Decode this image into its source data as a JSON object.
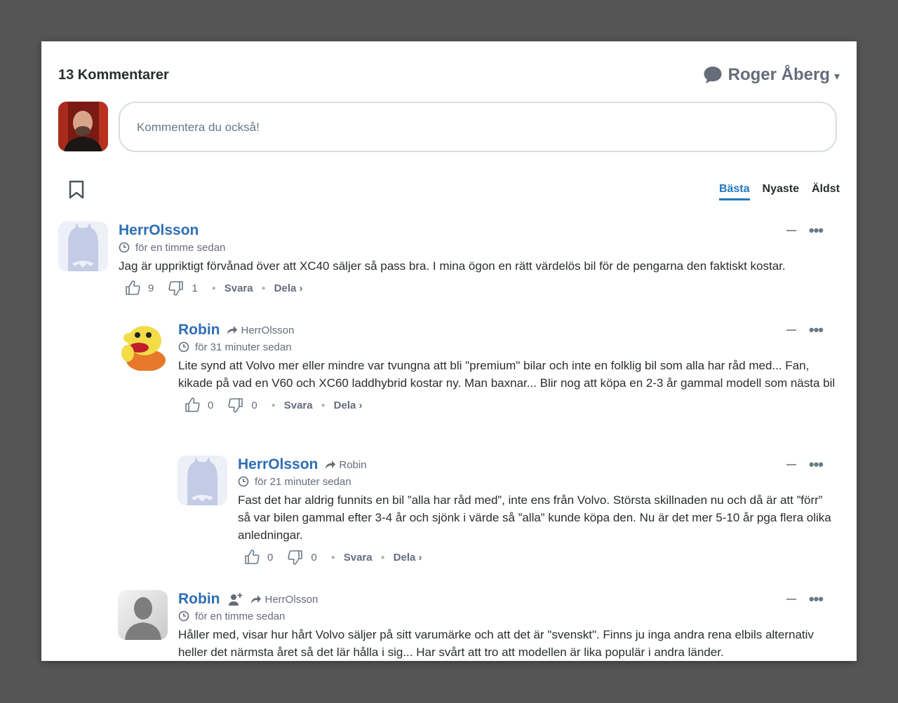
{
  "header": {
    "count_label": "13 Kommentarer",
    "user_name": "Roger Åberg",
    "caret": "▾"
  },
  "composer": {
    "placeholder": "Kommentera du också!"
  },
  "sort": {
    "best": "Bästa",
    "newest": "Nyaste",
    "oldest": "Äldst"
  },
  "comments": [
    {
      "author": "HerrOlsson",
      "reply_to": "",
      "time": "för en timme sedan",
      "text": "Jag är uppriktigt förvånad över att XC40 säljer så pass bra. I mina ögon en rätt värdelös bil för de pengarna den faktiskt kostar.",
      "upvotes": "9",
      "downvotes": "1",
      "reply": "Svara",
      "share": "Dela ›"
    },
    {
      "author": "Robin",
      "reply_to": "HerrOlsson",
      "time": "för 31 minuter sedan",
      "text": "Lite synd att Volvo mer eller mindre var tvungna att bli \"premium\" bilar och inte en folklig bil som alla har råd med... Fan, kikade på vad en V60 och XC60 laddhybrid kostar ny. Man baxnar... Blir nog att köpa en 2-3 år gammal modell som nästa bil",
      "upvotes": "0",
      "downvotes": "0",
      "reply": "Svara",
      "share": "Dela ›"
    },
    {
      "author": "HerrOlsson",
      "reply_to": "Robin",
      "time": "för 21 minuter sedan",
      "text": "Fast det har aldrig funnits en bil ”alla har råd med”, inte ens från Volvo. Största skillnaden nu och då är att ”förr” så var bilen gammal efter 3-4 år och sjönk i värde så ”alla” kunde köpa den. Nu är det mer 5-10 år pga flera olika anledningar.",
      "upvotes": "0",
      "downvotes": "0",
      "reply": "Svara",
      "share": "Dela ›"
    },
    {
      "author": "Robin",
      "reply_to": "HerrOlsson",
      "time": "för en timme sedan",
      "text": "Håller med, visar hur hårt Volvo säljer på sitt varumärke och att det är \"svenskt\". Finns ju inga andra rena elbils alternativ heller det närmsta året så det lär hålla i sig... Har svårt att tro att modellen är lika populär i andra länder.",
      "upvotes": "",
      "downvotes": "",
      "reply": "",
      "share": ""
    }
  ]
}
